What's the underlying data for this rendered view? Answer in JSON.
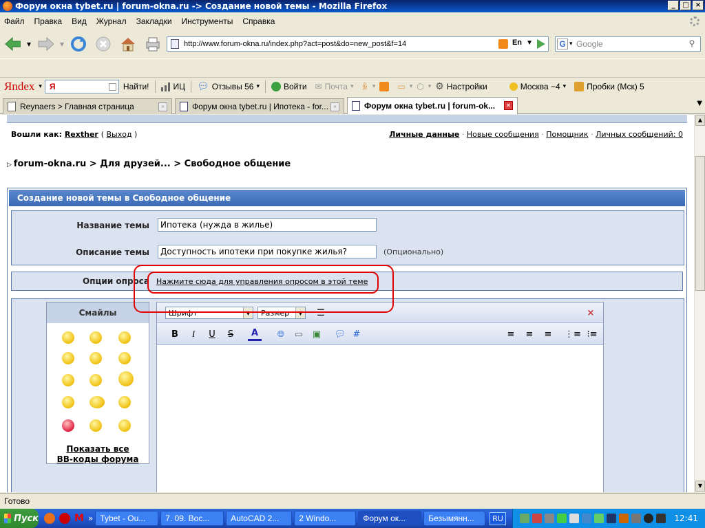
{
  "window": {
    "title": "Форум окна tybet.ru | forum-okna.ru -> Создание новой темы - Mozilla Firefox"
  },
  "menu": [
    "Файл",
    "Правка",
    "Вид",
    "Журнал",
    "Закладки",
    "Инструменты",
    "Справка"
  ],
  "nav": {
    "url": "http://www.forum-okna.ru/index.php?act=post&do=new_post&f=14",
    "search_placeholder": "Google"
  },
  "yandex": {
    "logo": "Яndex",
    "input_prefix": "Я",
    "find": "Найти!",
    "ic": "ИЦ",
    "reviews": "Отзывы 56",
    "login": "Войти",
    "mail": "Почта",
    "settings": "Настройки",
    "weather": "Москва −4",
    "traffic": "Пробки (Мск) 5"
  },
  "tabs": [
    {
      "label": "Reynaers > Главная страница"
    },
    {
      "label": "Форум окна tybet.ru | Ипотека - for..."
    },
    {
      "label": "Форум окна tybet.ru | forum-ok..."
    }
  ],
  "forum": {
    "logged_as": "Вошли как:",
    "username": "Rexther",
    "logout": "Выход",
    "user_links": [
      "Личные данные",
      "Новые сообщения",
      "Помощник",
      "Личных сообщений: 0"
    ],
    "breadcrumb": [
      "forum-okna.ru",
      "Для друзей...",
      "Свободное общение"
    ],
    "header": "Создание новой темы в Свободное общение",
    "topic_title_label": "Название темы",
    "topic_title_value": "Ипотека (нужда в жилье)",
    "topic_desc_label": "Описание темы",
    "topic_desc_value": "Доступность ипотеки при покупке жилья?",
    "optional": "(Опционально)",
    "poll_label": "Опции опроса",
    "poll_link": "Нажмите сюда для управления опросом в этой теме",
    "smilies_title": "Смайлы",
    "show_all": "Показать все",
    "bbcodes": "BB-коды форума",
    "font_select": "Шрифт",
    "size_select": "Размер"
  },
  "status": "Готово",
  "taskbar": {
    "start": "Пуск",
    "items": [
      "Tybet - Ou...",
      "7. 09. Вос...",
      "AutoCAD 2...",
      "2 Windo...",
      "Форум ок...",
      "Безымянн..."
    ],
    "lang": "RU",
    "time": "12:41"
  },
  "colors": {
    "forum_header": "#3c6ab5",
    "panel_bg": "#dbe3f0",
    "highlight": "#e00000"
  }
}
